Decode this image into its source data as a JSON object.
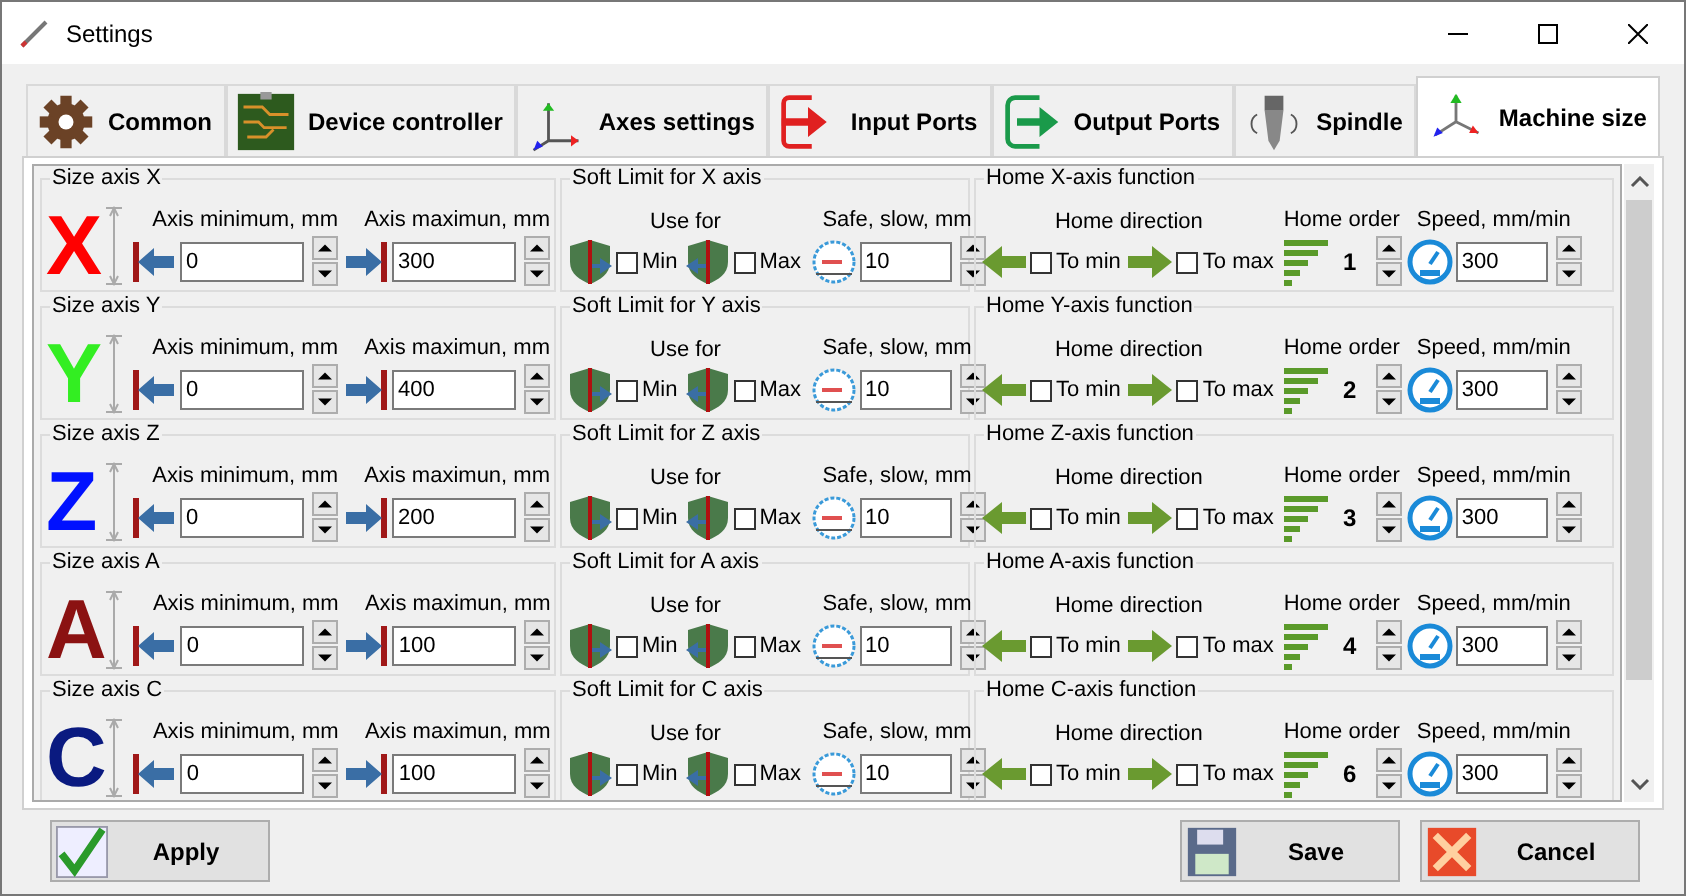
{
  "window": {
    "title": "Settings"
  },
  "tabs": [
    {
      "label": "Common",
      "kind": "gear",
      "selected": false
    },
    {
      "label": "Device controller",
      "kind": "board",
      "selected": false
    },
    {
      "label": "Axes settings",
      "kind": "axes",
      "selected": false
    },
    {
      "label": "Input Ports",
      "kind": "input",
      "selected": false
    },
    {
      "label": "Output Ports",
      "kind": "output",
      "selected": false
    },
    {
      "label": "Spindle",
      "kind": "spindle",
      "selected": false
    },
    {
      "label": "Machine size",
      "kind": "machine",
      "selected": true
    }
  ],
  "axes": [
    {
      "size_title": "Size axis X",
      "letter": "X",
      "color": "#ff0000",
      "min_label": "Axis minimum, mm",
      "min": "0",
      "max_label": "Axis maximun, mm",
      "max": "300",
      "soft_title": "Soft Limit for X axis",
      "use_for_label": "Use for",
      "soft_min": {
        "label": "Min",
        "checked": false
      },
      "soft_max": {
        "label": "Max",
        "checked": false
      },
      "safe_label": "Safe, slow, mm",
      "safe": "10",
      "home_title": "Home X-axis function",
      "direction_label": "Home direction",
      "to_min": {
        "label": "To min",
        "checked": false
      },
      "to_max": {
        "label": "To max",
        "checked": false
      },
      "order_label": "Home order",
      "order": "1",
      "speed_label": "Speed, mm/min",
      "speed": "300"
    },
    {
      "size_title": "Size axis Y",
      "letter": "Y",
      "color": "#33ee22",
      "min_label": "Axis minimum, mm",
      "min": "0",
      "max_label": "Axis maximun, mm",
      "max": "400",
      "soft_title": "Soft Limit for Y axis",
      "use_for_label": "Use for",
      "soft_min": {
        "label": "Min",
        "checked": false
      },
      "soft_max": {
        "label": "Max",
        "checked": false
      },
      "safe_label": "Safe, slow, mm",
      "safe": "10",
      "home_title": "Home Y-axis function",
      "direction_label": "Home direction",
      "to_min": {
        "label": "To min",
        "checked": false
      },
      "to_max": {
        "label": "To max",
        "checked": false
      },
      "order_label": "Home order",
      "order": "2",
      "speed_label": "Speed, mm/min",
      "speed": "300"
    },
    {
      "size_title": "Size axis Z",
      "letter": "Z",
      "color": "#0011ff",
      "min_label": "Axis minimum, mm",
      "min": "0",
      "max_label": "Axis maximun, mm",
      "max": "200",
      "soft_title": "Soft Limit for Z axis",
      "use_for_label": "Use for",
      "soft_min": {
        "label": "Min",
        "checked": false
      },
      "soft_max": {
        "label": "Max",
        "checked": false
      },
      "safe_label": "Safe, slow, mm",
      "safe": "10",
      "home_title": "Home Z-axis function",
      "direction_label": "Home direction",
      "to_min": {
        "label": "To min",
        "checked": false
      },
      "to_max": {
        "label": "To max",
        "checked": false
      },
      "order_label": "Home order",
      "order": "3",
      "speed_label": "Speed, mm/min",
      "speed": "300"
    },
    {
      "size_title": "Size axis A",
      "letter": "A",
      "color": "#8b1212",
      "min_label": "Axis minimum, mm",
      "min": "0",
      "max_label": "Axis maximun, mm",
      "max": "100",
      "soft_title": "Soft Limit for A axis",
      "use_for_label": "Use for",
      "soft_min": {
        "label": "Min",
        "checked": false
      },
      "soft_max": {
        "label": "Max",
        "checked": false
      },
      "safe_label": "Safe, slow, mm",
      "safe": "10",
      "home_title": "Home A-axis function",
      "direction_label": "Home direction",
      "to_min": {
        "label": "To min",
        "checked": false
      },
      "to_max": {
        "label": "To max",
        "checked": false
      },
      "order_label": "Home order",
      "order": "4",
      "speed_label": "Speed, mm/min",
      "speed": "300"
    },
    {
      "size_title": "Size axis C",
      "letter": "C",
      "color": "#0a1a80",
      "min_label": "Axis minimum, mm",
      "min": "0",
      "max_label": "Axis maximun, mm",
      "max": "100",
      "soft_title": "Soft Limit for C axis",
      "use_for_label": "Use for",
      "soft_min": {
        "label": "Min",
        "checked": false
      },
      "soft_max": {
        "label": "Max",
        "checked": false
      },
      "safe_label": "Safe, slow, mm",
      "safe": "10",
      "home_title": "Home C-axis function",
      "direction_label": "Home direction",
      "to_min": {
        "label": "To min",
        "checked": false
      },
      "to_max": {
        "label": "To max",
        "checked": false
      },
      "order_label": "Home order",
      "order": "6",
      "speed_label": "Speed, mm/min",
      "speed": "300"
    }
  ],
  "buttons": [
    {
      "label": "Apply",
      "kind": "apply"
    },
    {
      "label": "Save",
      "kind": "save"
    },
    {
      "label": "Cancel",
      "kind": "cancel"
    }
  ]
}
